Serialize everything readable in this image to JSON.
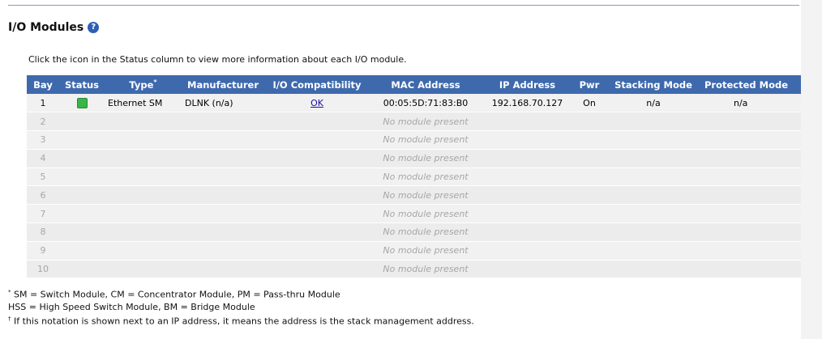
{
  "section": {
    "title": "I/O Modules",
    "help_icon": "help-icon",
    "intro": "Click the icon in the Status column to view more information about each I/O module."
  },
  "table": {
    "headers": {
      "bay": "Bay",
      "status": "Status",
      "type": "Type",
      "type_mark": "*",
      "manufacturer": "Manufacturer",
      "compat": "I/O Compatibility",
      "mac": "MAC Address",
      "ip": "IP Address",
      "pwr": "Pwr",
      "stacking": "Stacking Mode",
      "protected": "Protected Mode"
    },
    "rows": [
      {
        "bay": "1",
        "status_color": "#39b54a",
        "type": "Ethernet SM",
        "manufacturer": "DLNK (n/a)",
        "compat": "OK",
        "mac": "00:05:5D:71:83:B0",
        "ip": "192.168.70.127",
        "pwr": "On",
        "stacking": "n/a",
        "protected": "n/a"
      },
      {
        "bay": "2",
        "mac": "No module present"
      },
      {
        "bay": "3",
        "mac": "No module present"
      },
      {
        "bay": "4",
        "mac": "No module present"
      },
      {
        "bay": "5",
        "mac": "No module present"
      },
      {
        "bay": "6",
        "mac": "No module present"
      },
      {
        "bay": "7",
        "mac": "No module present"
      },
      {
        "bay": "8",
        "mac": "No module present"
      },
      {
        "bay": "9",
        "mac": "No module present"
      },
      {
        "bay": "10",
        "mac": "No module present"
      }
    ]
  },
  "notes": {
    "mark1": "*",
    "line1": "SM = Switch Module, CM = Concentrator Module, PM = Pass-thru Module",
    "line2": "HSS = High Speed Switch Module, BM = Bridge Module",
    "mark2": "†",
    "line3": "If this notation is shown next to an IP address, it means the address is the stack management address."
  }
}
